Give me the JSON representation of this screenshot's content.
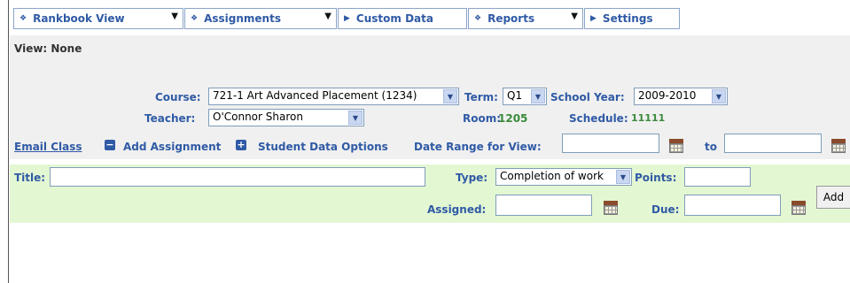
{
  "tabs": [
    {
      "label": "Rankbook View",
      "icon": "diamond-icon",
      "dropdown": true
    },
    {
      "label": "Assignments",
      "icon": "diamond-icon",
      "dropdown": true
    },
    {
      "label": "Custom Data",
      "icon": "play-icon",
      "dropdown": false
    },
    {
      "label": "Reports",
      "icon": "diamond-icon",
      "dropdown": true
    },
    {
      "label": "Settings",
      "icon": "play-icon",
      "dropdown": false
    }
  ],
  "view": {
    "label": "View: None"
  },
  "course": {
    "label": "Course:",
    "value": "721-1 Art Advanced Placement (1234)"
  },
  "term": {
    "label": "Term:",
    "value": "Q1"
  },
  "school_year": {
    "label": "School Year:",
    "value": "2009-2010"
  },
  "teacher": {
    "label": "Teacher:",
    "value": "O'Connor Sharon"
  },
  "room": {
    "label": "Room:",
    "value": "1205"
  },
  "schedule": {
    "label": "Schedule:",
    "value": "11111"
  },
  "actions": {
    "email_class": "Email Class",
    "add_assignment": "Add Assignment",
    "student_data_options": "Student Data Options",
    "date_range_label": "Date Range for View:",
    "to_label": "to"
  },
  "assignment_form": {
    "title_label": "Title:",
    "type_label": "Type:",
    "type_value": "Completion of work",
    "points_label": "Points:",
    "assigned_label": "Assigned:",
    "due_label": "Due:",
    "add_label": "Add"
  }
}
